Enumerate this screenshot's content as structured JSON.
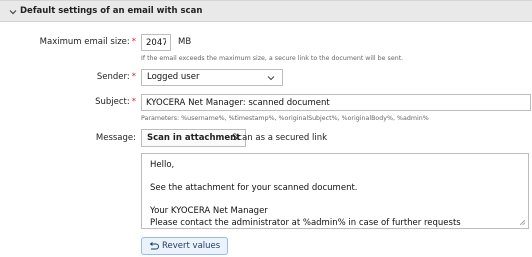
{
  "section": {
    "title": "Default settings of an email with scan"
  },
  "max_size": {
    "label": "Maximum email size:",
    "value": "2047",
    "unit": "MB",
    "hint": "If the email exceeds the maximum size, a secure link to the document will be sent."
  },
  "sender": {
    "label": "Sender:",
    "value": "Logged user"
  },
  "subject": {
    "label": "Subject:",
    "value": "KYOCERA Net Manager: scanned document",
    "hint": "Parameters: %username%, %timestamp%, %originalSubject%, %originalBody%, %admin%"
  },
  "message": {
    "label": "Message:",
    "tabs": [
      "Scan in attachment",
      "Scan as a secured link"
    ],
    "lines": [
      "Hello,",
      "",
      "See the attachment for your scanned document.",
      "",
      "Your KYOCERA Net Manager",
      "Please contact the administrator at %admin% in case of further requests"
    ]
  },
  "revert_button": {
    "label": "Revert values"
  },
  "colors": {
    "required": "#d7263d",
    "header_bg": "#e9e9e9",
    "button_bg": "#eaf2fc"
  },
  "icons": {
    "collapse": "chevron-down-icon",
    "dropdown": "caret-down-icon",
    "revert": "undo-arrow-icon"
  }
}
